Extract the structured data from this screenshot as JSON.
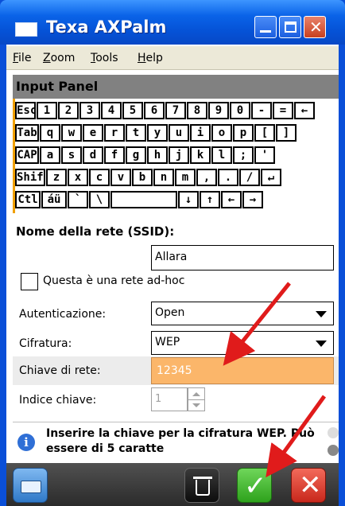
{
  "window": {
    "title": "Texa AXPalm"
  },
  "menu": [
    "File",
    "Zoom",
    "Tools",
    "Help"
  ],
  "input_panel": {
    "title": "Input Panel",
    "rows": [
      [
        "Esc",
        "1",
        "2",
        "3",
        "4",
        "5",
        "6",
        "7",
        "8",
        "9",
        "0",
        "-",
        "=",
        "←"
      ],
      [
        "Tab",
        "q",
        "w",
        "e",
        "r",
        "t",
        "y",
        "u",
        "i",
        "o",
        "p",
        "[",
        "]"
      ],
      [
        "CAP",
        "a",
        "s",
        "d",
        "f",
        "g",
        "h",
        "j",
        "k",
        "l",
        ";",
        "'"
      ],
      [
        "Shift",
        "z",
        "x",
        "c",
        "v",
        "b",
        "n",
        "m",
        ",",
        ".",
        "/",
        "↵"
      ],
      [
        "Ctl",
        "áü",
        "`",
        "\\",
        "",
        "↓",
        "↑",
        "←",
        "→"
      ]
    ]
  },
  "form": {
    "ssid_label": "Nome della rete (SSID):",
    "ssid_value": "Allara",
    "adhoc_label": "Questa è una rete ad-hoc",
    "auth_label": "Autenticazione:",
    "auth_value": "Open",
    "cipher_label": "Cifratura:",
    "cipher_value": "WEP",
    "key_label": "Chiave di rete:",
    "key_value": "12345",
    "index_label": "Indice chiave:",
    "index_value": "1"
  },
  "info": {
    "text": "Inserire la chiave per la cifratura WEP. Può essere di 5 caratte"
  },
  "icons": {
    "keyboard": "keyboard-icon",
    "trash": "trash-icon",
    "ok": "checkmark-icon",
    "cancel": "close-icon",
    "info": "info-icon"
  },
  "colors": {
    "title_bar": "#0a63e8",
    "key_field": "#fbb66a",
    "ok": "#2ea21c",
    "cancel": "#c8281c",
    "annotation": "#e01b1b"
  }
}
